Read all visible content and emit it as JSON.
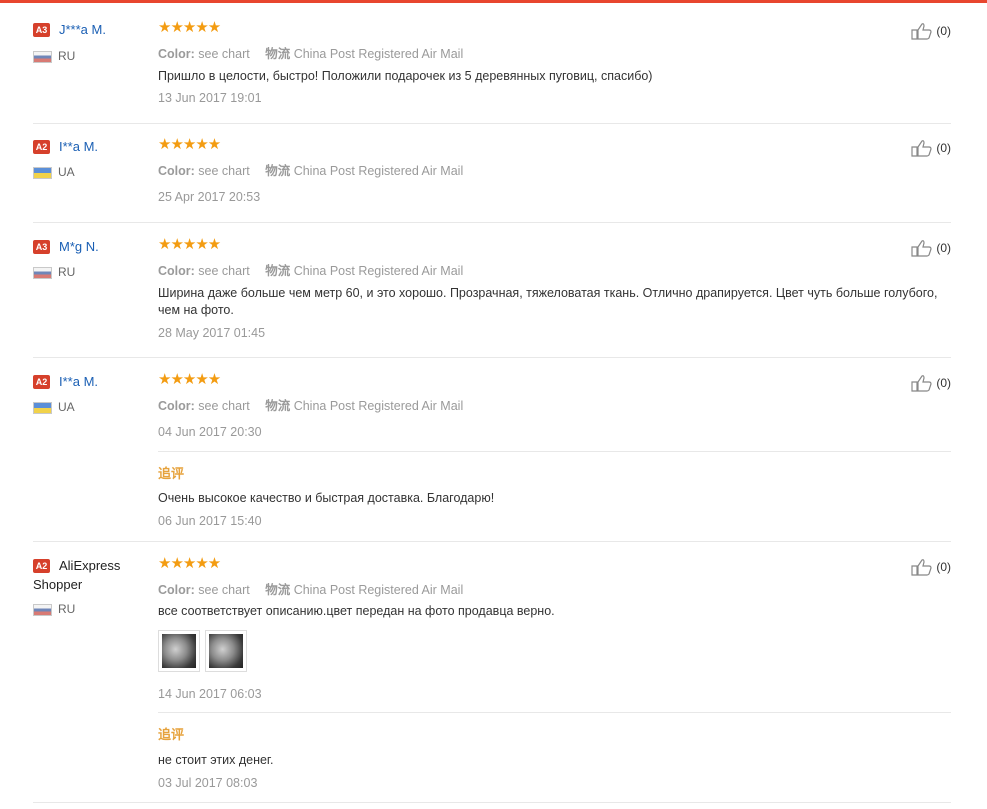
{
  "color_label": "Color:",
  "color_value": "see chart",
  "shipping_label": "物流",
  "shipping_value": "China Post Registered Air Mail",
  "additional_label": "追评",
  "reviews": [
    {
      "badge": "A3",
      "username": "J***a M.",
      "country": "RU",
      "flag": "ru",
      "stars": "★★★★★",
      "text": "Пришло в целости, быстро! Положили подарочек из 5 деревянных пуговиц, спасибо)",
      "date": "13 Jun 2017 19:01",
      "likes": "(0)"
    },
    {
      "badge": "A2",
      "username": "I**a M.",
      "country": "UA",
      "flag": "ua",
      "stars": "★★★★★",
      "text": "",
      "date": "25 Apr 2017 20:53",
      "likes": "(0)"
    },
    {
      "badge": "A3",
      "username": "M*g N.",
      "country": "RU",
      "flag": "ru",
      "stars": "★★★★★",
      "text": "Ширина даже больше чем метр 60, и это хорошо. Прозрачная, тяжеловатая ткань. Отлично драпируется. Цвет чуть больше голубого, чем на фото.",
      "date": "28 May 2017 01:45",
      "likes": "(0)"
    },
    {
      "badge": "A2",
      "username": "I**a M.",
      "country": "UA",
      "flag": "ua",
      "stars": "★★★★★",
      "text": "",
      "date": "04 Jun 2017 20:30",
      "likes": "(0)",
      "additional_text": "Очень высокое качество и быстрая доставка. Благодарю!",
      "additional_date": "06 Jun 2017 15:40"
    },
    {
      "badge": "A2",
      "username": "AliExpress Shopper",
      "country": "RU",
      "flag": "ru",
      "stars": "★★★★★",
      "text": "все соответствует описанию.цвет передан на фото продавца верно.",
      "date": "14 Jun 2017 06:03",
      "likes": "(0)",
      "additional_text": "не стоит этих денег.",
      "additional_date": "03 Jul 2017 08:03"
    }
  ]
}
